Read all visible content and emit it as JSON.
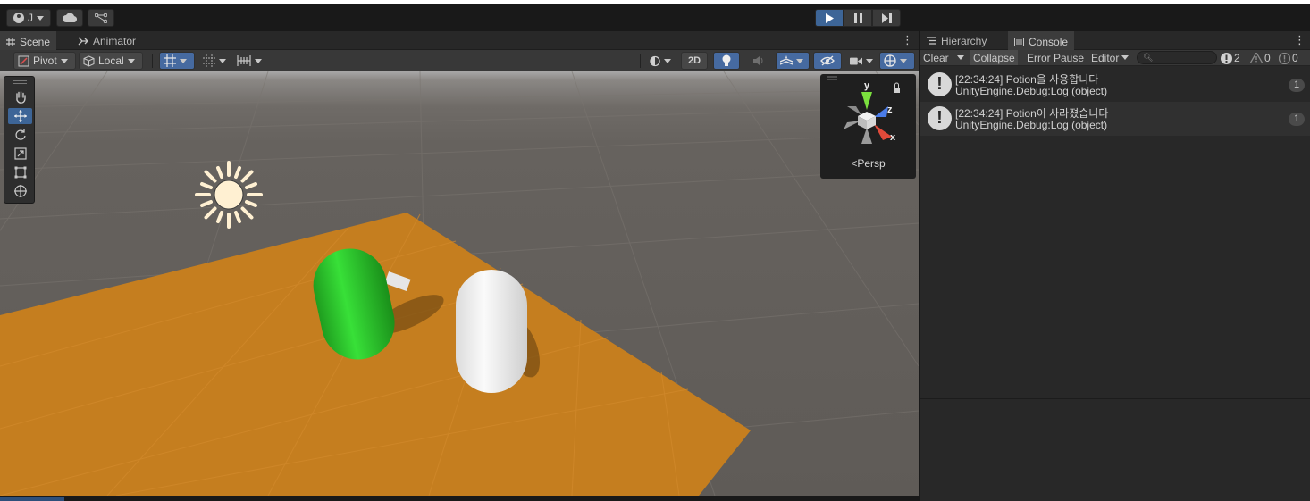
{
  "toolbar": {
    "account_initial": "J"
  },
  "scene_panel": {
    "tabs": [
      {
        "label": "Scene",
        "icon": "grid-icon"
      },
      {
        "label": "Animator",
        "icon": "animator-icon"
      }
    ],
    "pivot_label": "Pivot",
    "local_label": "Local",
    "mode_2d_label": "2D",
    "gizmo_projection_label": "Persp",
    "gizmo_axes": {
      "y": "y",
      "z": "z",
      "x": "x"
    }
  },
  "console_panel": {
    "tabs": [
      {
        "label": "Hierarchy",
        "icon": "list-icon"
      },
      {
        "label": "Console",
        "icon": "console-icon"
      }
    ],
    "toolbar": {
      "clear_label": "Clear",
      "collapse_label": "Collapse",
      "error_pause_label": "Error Pause",
      "editor_label": "Editor"
    },
    "counts": {
      "info": "2",
      "warning": "0",
      "error": "0"
    },
    "logs": [
      {
        "line1": "[22:34:24] Potion을 사용합니다",
        "line2": "UnityEngine.Debug:Log (object)",
        "count": "1"
      },
      {
        "line1": "[22:34:24] Potion이 사라졌습니다",
        "line2": "UnityEngine.Debug:Log (object)",
        "count": "1"
      }
    ]
  },
  "colors": {
    "play_active": "#3d6597",
    "plane": "#c57e1f",
    "green_capsule": "#2fd42f",
    "white_capsule": "#f2f2f2"
  }
}
